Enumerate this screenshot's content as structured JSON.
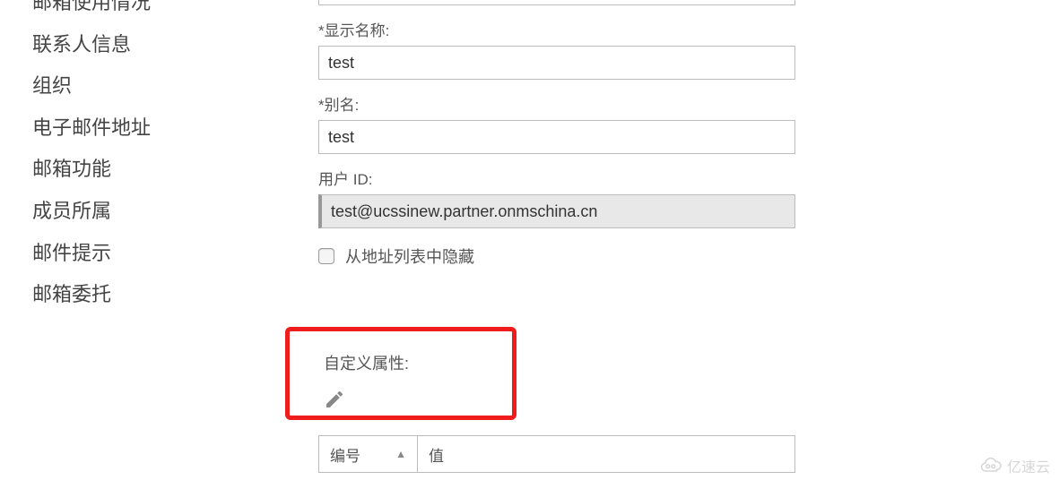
{
  "sidebar": {
    "items": [
      {
        "label": "邮箱使用情况"
      },
      {
        "label": "联系人信息"
      },
      {
        "label": "组织"
      },
      {
        "label": "电子邮件地址"
      },
      {
        "label": "邮箱功能"
      },
      {
        "label": "成员所属"
      },
      {
        "label": "邮件提示"
      },
      {
        "label": "邮箱委托"
      }
    ]
  },
  "form": {
    "display_name_label": "*显示名称:",
    "display_name_value": "test",
    "alias_label": "*别名:",
    "alias_value": "test",
    "user_id_label": "用户 ID:",
    "user_id_value": "test@ucssinew.partner.onmschina.cn",
    "hide_checkbox_label": "从地址列表中隐藏"
  },
  "custom_attr": {
    "label": "自定义属性:"
  },
  "attr_table": {
    "col_num": "编号",
    "col_val": "值"
  },
  "watermark": {
    "text": "亿速云"
  }
}
